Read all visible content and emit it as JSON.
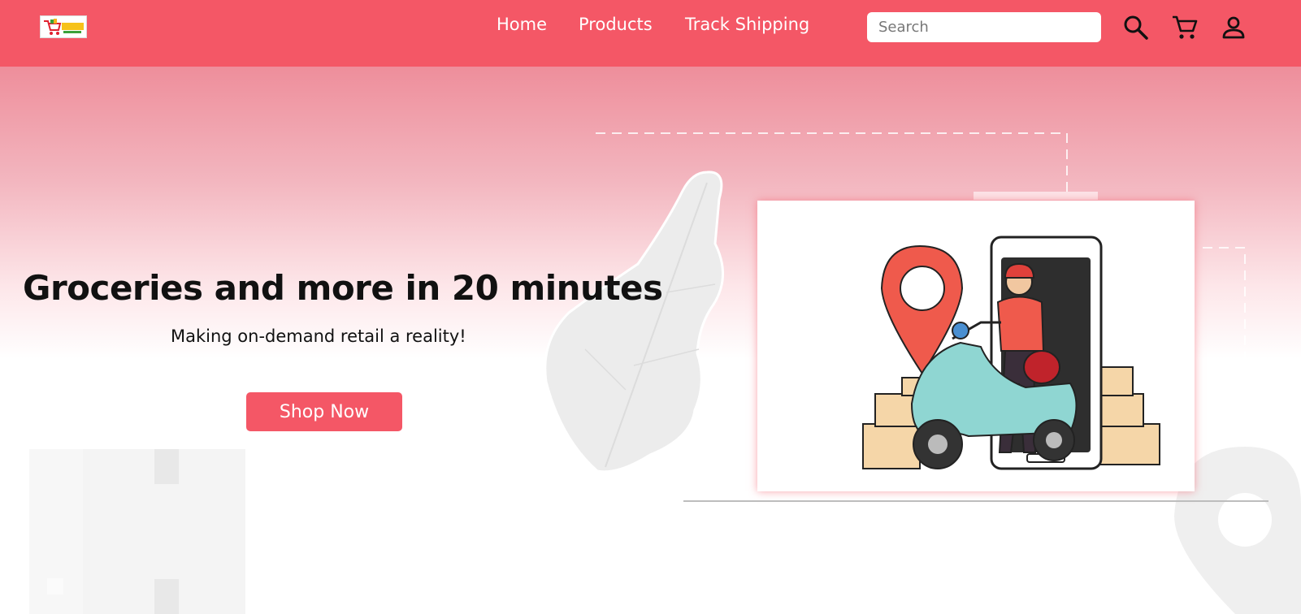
{
  "header": {
    "logo_alt": "store logo",
    "nav": [
      {
        "label": "Home"
      },
      {
        "label": "Products"
      },
      {
        "label": "Track Shipping"
      }
    ],
    "search": {
      "placeholder": "Search",
      "value": ""
    },
    "icons": [
      "search-icon",
      "cart-icon",
      "user-icon"
    ]
  },
  "hero": {
    "headline": "Groceries and more in 20 minutes",
    "subheadline": "Making on-demand retail a reality!",
    "cta_label": "Shop Now",
    "illustration": "delivery-scooter-illustration"
  },
  "colors": {
    "brand": "#f45766",
    "text": "#111111",
    "white": "#ffffff"
  }
}
